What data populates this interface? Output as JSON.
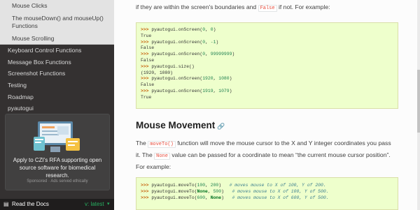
{
  "sidebar": {
    "sub_items": [
      "Mouse Clicks",
      "The mouseDown() and mouseUp() Functions",
      "Mouse Scrolling"
    ],
    "nav_items": [
      "Keyboard Control Functions",
      "Message Box Functions",
      "Screenshot Functions",
      "Testing",
      "Roadmap",
      "pyautogui"
    ],
    "ad": {
      "text": "Apply to CZI's RFA supporting open source software for biomedical research.",
      "sponsor": "Sponsored · Ads served ethically"
    },
    "rtd": {
      "label": "Read the Docs",
      "version": "v: latest",
      "caret": "▾"
    }
  },
  "content": {
    "intro_before": "if they are within the screen's boundaries and",
    "intro_code": "False",
    "intro_after": "if not. For example:",
    "code1": [
      {
        "prompt": ">>> ",
        "text": "pyautogui.onScreen(0, 0)"
      },
      {
        "prompt": "",
        "text": "True"
      },
      {
        "prompt": ">>> ",
        "text": "pyautogui.onScreen(0, -1)"
      },
      {
        "prompt": "",
        "text": "False"
      },
      {
        "prompt": ">>> ",
        "text": "pyautogui.onScreen(0, 99999999)"
      },
      {
        "prompt": "",
        "text": "False"
      },
      {
        "prompt": ">>> ",
        "text": "pyautogui.size()"
      },
      {
        "prompt": "",
        "text": "(1920, 1080)"
      },
      {
        "prompt": ">>> ",
        "text": "pyautogui.onScreen(1920, 1080)"
      },
      {
        "prompt": "",
        "text": "False"
      },
      {
        "prompt": ">>> ",
        "text": "pyautogui.onScreen(1919, 1079)"
      },
      {
        "prompt": "",
        "text": "True"
      }
    ],
    "heading": "Mouse Movement",
    "heading_link": "🔗",
    "para2": {
      "p1": "The",
      "code1": "moveTo()",
      "p2": "function will move the mouse cursor to the X and Y integer coordinates you pass it. The",
      "code2": "None",
      "p3": "value can be passed for a coordinate to mean “the current mouse cursor position”. For example:"
    },
    "code2": [
      {
        "prompt": ">>> ",
        "call": "pyautogui.moveTo(100, 200)",
        "comment": "# moves mouse to X of 100, Y of 200."
      },
      {
        "prompt": ">>> ",
        "call": "pyautogui.moveTo(None, 500)",
        "comment": "# moves mouse to X of 100, Y of 500."
      },
      {
        "prompt": ">>> ",
        "call": "pyautogui.moveTo(600, None)",
        "comment": "# moves mouse to X of 600, Y of 500."
      }
    ]
  },
  "colors": {
    "sidebar_bg": "#343131",
    "code_bg": "#eeffcc",
    "literal": "#e74c3c",
    "version_green": "#27ae60"
  }
}
